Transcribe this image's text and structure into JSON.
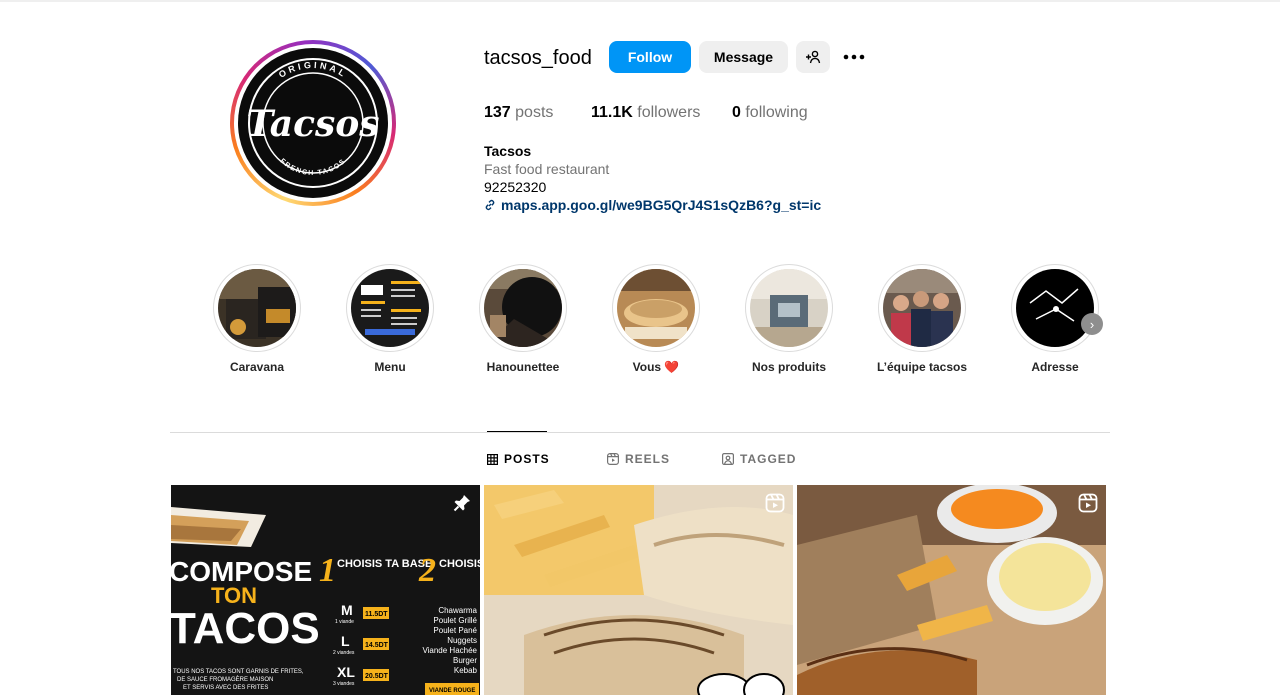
{
  "profile": {
    "username": "tacsos_food",
    "follow_label": "Follow",
    "message_label": "Message",
    "avatar": {
      "logo_top": "ORIGINAL",
      "logo_main": "Tacsos",
      "logo_bottom": "FRENCH TACOS"
    },
    "stats": {
      "posts_count": "137",
      "posts_label": "posts",
      "followers_count": "11.1K",
      "followers_label": "followers",
      "following_count": "0",
      "following_label": "following"
    },
    "bio": {
      "name": "Tacsos",
      "category": "Fast food restaurant",
      "phone": "92252320",
      "link": "maps.app.goo.gl/we9BG5QrJ4S1sQzB6?g_st=ic"
    }
  },
  "highlights": [
    {
      "label": "Caravana"
    },
    {
      "label": "Menu"
    },
    {
      "label": "Hanounettee"
    },
    {
      "label": "Vous ❤️"
    },
    {
      "label": "Nos produits"
    },
    {
      "label": "L’équipe tacsos"
    },
    {
      "label": "Adresse"
    }
  ],
  "tabs": {
    "posts": "POSTS",
    "reels": "REELS",
    "tagged": "TAGGED",
    "active": "posts"
  },
  "posts": [
    {
      "type": "pinned",
      "headline": [
        "COMPOSE",
        "TON",
        "TACOS"
      ],
      "step1": {
        "num": "1",
        "text": "CHOISIS TA BASE"
      },
      "step2": {
        "num": "2",
        "text": "CHOISIS TA VIANDE"
      },
      "sizes": [
        {
          "size": "M",
          "sub": "1 viande",
          "price": "11.5DT"
        },
        {
          "size": "L",
          "sub": "2 viandes",
          "price": "14.5DT"
        },
        {
          "size": "XL",
          "sub": "3 viandes",
          "price": "20.5DT"
        }
      ],
      "meats": [
        "Chawarma",
        "Poulet Grillé",
        "Poulet Pané",
        "Nuggets",
        "Viande Hachée",
        "Burger",
        "Kebab"
      ],
      "footnote": [
        "TOUS NOS TACOS SONT GARNIS DE FRITES,",
        "DE SAUCE FROMAGÈRE MAISON",
        "ET SERVIS AVEC DES FRITES"
      ],
      "tag": "VIANDE ROUGE"
    },
    {
      "type": "reel"
    },
    {
      "type": "reel"
    }
  ]
}
